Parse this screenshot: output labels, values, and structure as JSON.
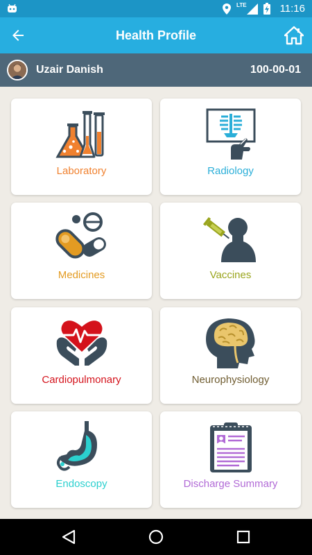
{
  "status_bar": {
    "network": "LTE",
    "time": "11:16"
  },
  "app_bar": {
    "title": "Health Profile"
  },
  "user": {
    "name": "Uzair Danish",
    "mrn": "100-00-01"
  },
  "tiles": [
    {
      "label": "Laboratory",
      "icon": "lab-flasks-icon",
      "color": "#f0812f"
    },
    {
      "label": "Radiology",
      "icon": "xray-icon",
      "color": "#2aaed8"
    },
    {
      "label": "Medicines",
      "icon": "pills-icon",
      "color": "#e39b22"
    },
    {
      "label": "Vaccines",
      "icon": "syringe-person-icon",
      "color": "#9aa51d"
    },
    {
      "label": "Cardiopulmonary",
      "icon": "heart-hands-icon",
      "color": "#d4121b"
    },
    {
      "label": "Neurophysiology",
      "icon": "brain-head-icon",
      "color": "#6f5c30"
    },
    {
      "label": "Endoscopy",
      "icon": "stomach-icon",
      "color": "#2bd0cf"
    },
    {
      "label": "Discharge Summary",
      "icon": "clipboard-icon",
      "color": "#b16ad6"
    }
  ],
  "colors": {
    "status_bar": "#1c95c6",
    "app_bar": "#27aee0",
    "user_bar": "#4e6779",
    "background": "#efece6"
  }
}
